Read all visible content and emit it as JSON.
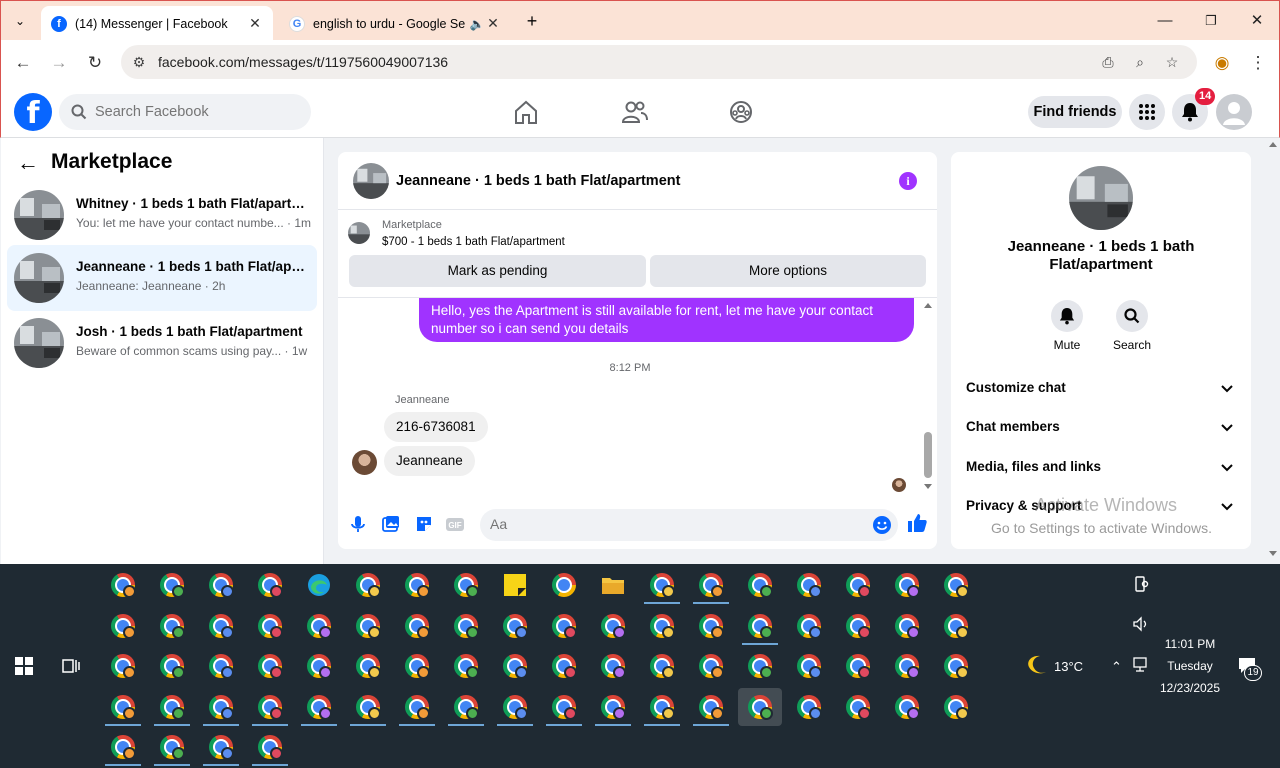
{
  "browser": {
    "tabs": [
      {
        "title": "(14) Messenger | Facebook",
        "favicon": "facebook-icon",
        "active": true
      },
      {
        "title": "english to urdu - Google Se",
        "favicon": "google-icon",
        "active": false
      }
    ],
    "url": "facebook.com/messages/t/1197560049007136"
  },
  "header": {
    "search_placeholder": "Search Facebook",
    "find_friends": "Find friends",
    "notification_count": "14",
    "nav": [
      "home-icon",
      "friends-icon",
      "groups-icon"
    ]
  },
  "sidebar": {
    "title": "Marketplace",
    "conversations": [
      {
        "name": "Whitney · 1 beds 1 bath Flat/apartment",
        "snippet": "You: let me have your contact numbe...",
        "time": " · 1m",
        "active": false
      },
      {
        "name": "Jeanneane · 1 beds 1 bath Flat/apartment",
        "snippet": "Jeanneane: Jeanneane",
        "time": " · 2h",
        "active": true
      },
      {
        "name": "Josh · 1 beds 1 bath Flat/apartment",
        "snippet": "Beware of common scams using pay...",
        "time": " · 1w",
        "active": false
      }
    ]
  },
  "chat": {
    "title": "Jeanneane · 1 beds 1 bath Flat/apartment",
    "listing_source": "Marketplace",
    "listing_price": "$700 - 1 beds 1 bath Flat/apartment",
    "mark_pending": "Mark as pending",
    "more_options": "More options",
    "messages": {
      "outgoing": "Hello, yes the Apartment is still available for rent, let me have your contact number so i can send you details",
      "timestamp": "8:12 PM",
      "sender": "Jeanneane",
      "incoming": [
        "216-6736081",
        "Jeanneane"
      ]
    },
    "composer_placeholder": "Aa",
    "accent_color": "#a033ff"
  },
  "details": {
    "name": "Jeanneane · 1 beds 1 bath Flat/apartment",
    "actions": [
      {
        "label": "Mute",
        "icon": "bell-icon"
      },
      {
        "label": "Search",
        "icon": "search-icon"
      }
    ],
    "sections": [
      "Customize chat",
      "Chat members",
      "Media, files and links",
      "Privacy & support"
    ]
  },
  "watermark": {
    "line1": "Activate Windows",
    "line2": "Go to Settings to activate Windows."
  },
  "taskbar": {
    "weather": "13°C",
    "time": "11:01 PM",
    "day": "Tuesday",
    "date": "12/23/2025",
    "notifications": "19"
  }
}
